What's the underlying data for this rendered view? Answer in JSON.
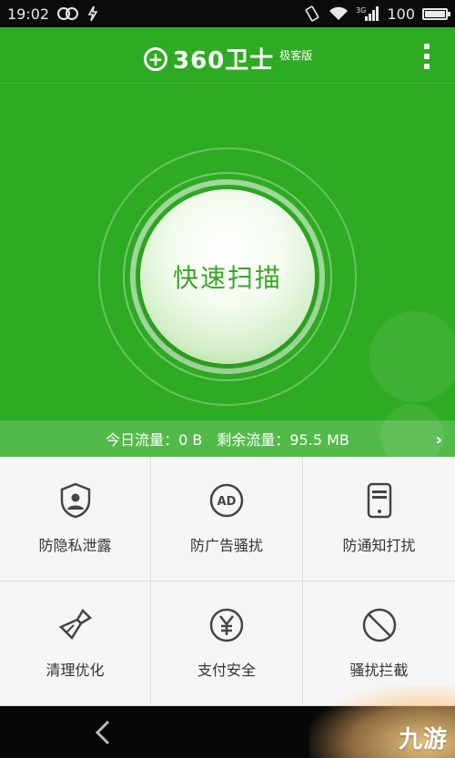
{
  "status_bar": {
    "time": "19:02",
    "battery_level": "100",
    "network_type": "3G",
    "icons": [
      "link-icon",
      "flash-icon",
      "vibrate-icon",
      "wifi-icon",
      "signal-icon",
      "battery-icon"
    ]
  },
  "header": {
    "app_name": "360卫士",
    "edition": "极客版",
    "menu_icon": "more-vertical-icon"
  },
  "scan": {
    "button_label": "快速扫描"
  },
  "traffic": {
    "today": "今日流量：0 B",
    "remaining": "剩余流量：95.5 MB",
    "arrow_icon": "chevron-right-icon"
  },
  "features": [
    {
      "label": "防隐私泄露",
      "icon": "privacy-shield-icon"
    },
    {
      "label": "防广告骚扰",
      "icon": "ad-block-icon"
    },
    {
      "label": "防通知打扰",
      "icon": "notification-phone-icon"
    },
    {
      "label": "清理优化",
      "icon": "broom-icon"
    },
    {
      "label": "支付安全",
      "icon": "yuan-payment-icon"
    },
    {
      "label": "骚扰拦截",
      "icon": "block-icon"
    }
  ],
  "nav": {
    "back_icon": "back-arrow-icon"
  },
  "watermark": {
    "text": "九游"
  },
  "colors": {
    "primary_green": "#2eab23",
    "scan_text": "#3aa52a",
    "icon_gray": "#444444"
  }
}
